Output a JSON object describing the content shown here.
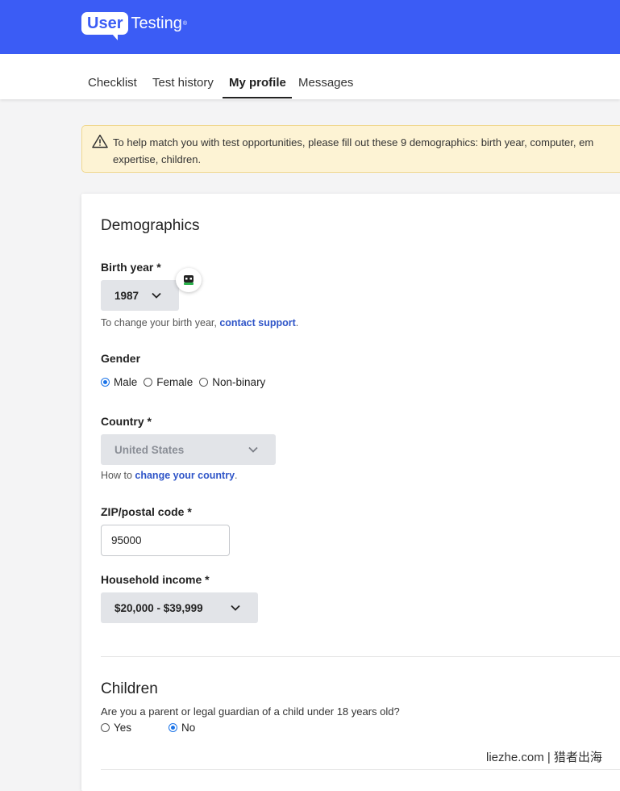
{
  "header": {
    "logo_badge": "User",
    "logo_text": "Testing",
    "logo_tm": "®",
    "brand_color": "#3b5cf5"
  },
  "nav": {
    "tabs": [
      {
        "label": "Checklist"
      },
      {
        "label": "Test history"
      },
      {
        "label": "My profile",
        "active": true
      },
      {
        "label": "Messages"
      }
    ]
  },
  "alert": {
    "icon": "warning-icon",
    "line1": "To help match you with test opportunities, please fill out these 9 demographics: birth year, computer, em",
    "line2": "expertise, children."
  },
  "demographics": {
    "title": "Demographics",
    "birth_year": {
      "label": "Birth year *",
      "value": "1987",
      "helper_prefix": "To change your birth year, ",
      "helper_link": "contact support",
      "helper_suffix": "."
    },
    "gender": {
      "label": "Gender",
      "options": [
        "Male",
        "Female",
        "Non-binary"
      ],
      "selected": "Male"
    },
    "country": {
      "label": "Country *",
      "value": "United States",
      "helper_prefix": "How to ",
      "helper_link": "change your country",
      "helper_suffix": "."
    },
    "zip": {
      "label": "ZIP/postal code *",
      "value": "95000"
    },
    "income": {
      "label": "Household income *",
      "value": "$20,000 - $39,999"
    }
  },
  "children": {
    "title": "Children",
    "question": "Are you a parent or legal guardian of a child under 18 years old?",
    "options": [
      "Yes",
      "No"
    ],
    "selected": "No"
  },
  "watermark": "liezhe.com | 猎者出海"
}
